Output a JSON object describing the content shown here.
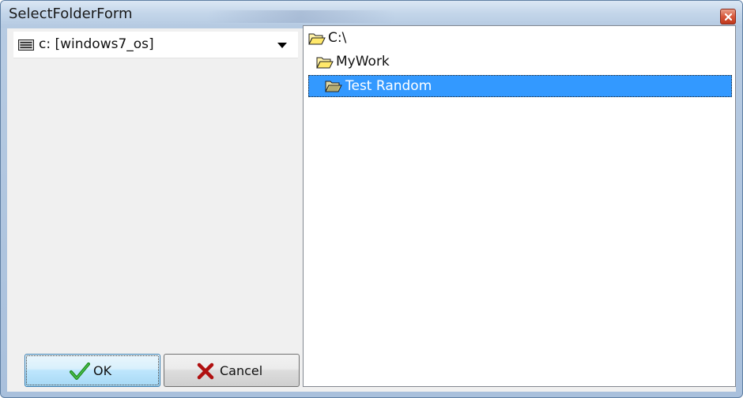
{
  "window": {
    "title": "SelectFolderForm",
    "accent_color": "#3399ff",
    "close_icon": "close-icon"
  },
  "drive_selector": {
    "selected": "c: [windows7_os]",
    "icon": "drive-icon"
  },
  "buttons": {
    "ok_label": "OK",
    "cancel_label": "Cancel",
    "ok_icon": "checkmark-icon",
    "cancel_icon": "x-mark-icon"
  },
  "folder_tree": {
    "items": [
      {
        "label": "C:\\",
        "level": 0,
        "selected": false
      },
      {
        "label": "MyWork",
        "level": 1,
        "selected": false
      },
      {
        "label": "Test Random",
        "level": 2,
        "selected": true
      }
    ]
  }
}
